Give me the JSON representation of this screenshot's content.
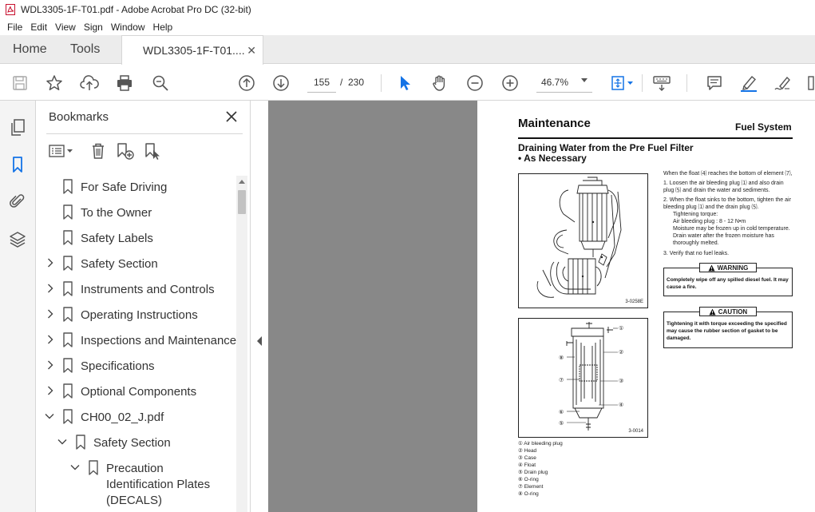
{
  "window": {
    "title": "WDL3305-1F-T01.pdf - Adobe Acrobat Pro DC (32-bit)"
  },
  "menu": [
    "File",
    "Edit",
    "View",
    "Sign",
    "Window",
    "Help"
  ],
  "tabs": {
    "home": "Home",
    "tools": "Tools",
    "document": "WDL3305-1F-T01...."
  },
  "toolbar": {
    "current_page": "155",
    "separator": "/",
    "total_pages": "230",
    "zoom": "46.7%"
  },
  "bookmarks": {
    "title": "Bookmarks",
    "items": [
      {
        "label": "For Safe Driving"
      },
      {
        "label": "To the Owner"
      },
      {
        "label": "Safety Labels"
      },
      {
        "label": "Safety Section"
      },
      {
        "label": "Instruments and Controls"
      },
      {
        "label": "Operating Instructions"
      },
      {
        "label": "Inspections and Maintenance"
      },
      {
        "label": "Specifications"
      },
      {
        "label": "Optional Components"
      },
      {
        "label": "CH00_02_J.pdf"
      },
      {
        "label": "Safety Section"
      },
      {
        "label": "Precaution Identification Plates (DECALS)"
      }
    ]
  },
  "page": {
    "heading": "Maintenance",
    "section": "Fuel System",
    "subheading_line1": "Draining Water from the Pre Fuel Filter",
    "subheading_line2": "• As Necessary",
    "fig1_code": "3-0258E",
    "fig2_code": "3-0014",
    "intro": "When the float ⑷ reaches the bottom of element ⑺,",
    "step1": "1.  Loosen the air bleeding plug ⑴ and also drain plug ⑸ and drain the water and sediments.",
    "step2": "2.  When the float sinks to the bottom, tighten the air bleeding plug ⑴ and the drain plug ⑸.",
    "torque_label": "Tightening torque:",
    "torque_value": "Air bleeding plug : 8 - 12 N•m",
    "note1": "Moisture may be frozen up in cold temperature.",
    "note2": "Drain water after the frozen moisture has thoroughly melted.",
    "step3": "3.  Verify that no fuel leaks.",
    "warning_title": "WARNING",
    "warning_text": "Completely wipe off any spilled diesel fuel. It may cause a fire.",
    "caution_title": "CAUTION",
    "caution_text": "Tightening it with torque exceeding the specified may cause the rubber section of gasket to be damaged.",
    "legend": [
      "① Air bleeding plug",
      "② Head",
      "③ Case",
      "④ Float",
      "⑤ Drain plug",
      "⑥ O-ring",
      "⑦ Element",
      "⑧ O-ring"
    ]
  },
  "colors": {
    "accent": "#1473e6",
    "doc_background": "#888888",
    "tab_background": "#ececec"
  }
}
